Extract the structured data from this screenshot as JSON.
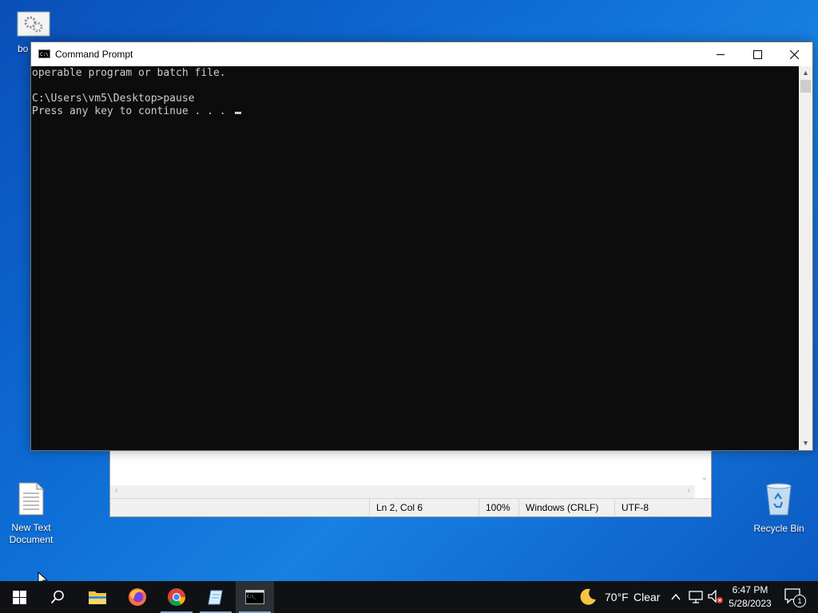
{
  "desktop": {
    "icons": [
      {
        "label": "bo"
      },
      {
        "label": "New Text Document"
      },
      {
        "label": "Recycle Bin"
      }
    ]
  },
  "cmd": {
    "title": "Command Prompt",
    "lines": [
      "operable program or batch file.",
      "",
      "C:\\Users\\vm5\\Desktop>pause",
      "Press any key to continue . . . "
    ]
  },
  "notepad": {
    "status": {
      "position": "Ln 2, Col 6",
      "zoom": "100%",
      "line_ending": "Windows (CRLF)",
      "encoding": "UTF-8"
    }
  },
  "taskbar": {
    "apps": [
      "Start",
      "Search",
      "File Explorer",
      "Firefox",
      "Google Chrome",
      "Notepad",
      "Command Prompt"
    ],
    "weather": {
      "temp": "70°F",
      "condition": "Clear"
    },
    "clock": {
      "time": "6:47 PM",
      "date": "5/28/2023"
    },
    "notification_count": "1"
  },
  "colors": {
    "console_bg": "#0c0c0c",
    "console_fg": "#cccccc",
    "taskbar": "#0f1114"
  }
}
